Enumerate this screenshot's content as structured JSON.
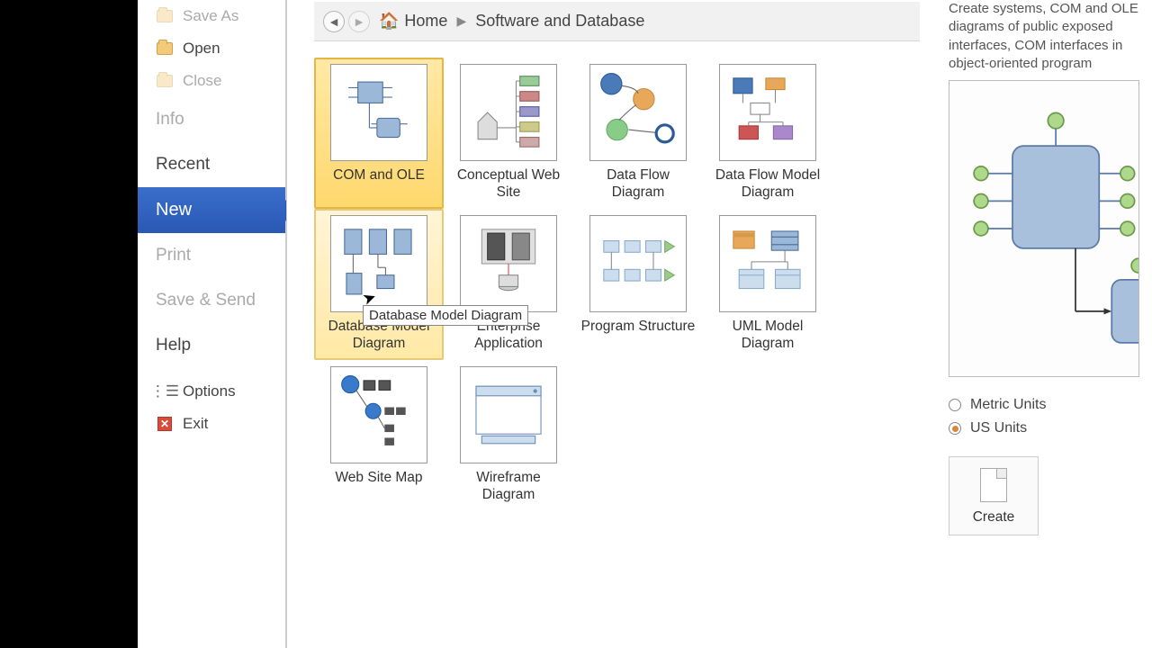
{
  "sidebar": {
    "save_as": "Save As",
    "open": "Open",
    "close": "Close",
    "info": "Info",
    "recent": "Recent",
    "new": "New",
    "print": "Print",
    "save_send": "Save & Send",
    "help": "Help",
    "options": "Options",
    "exit": "Exit"
  },
  "breadcrumb": {
    "home": "Home",
    "current": "Software and Database"
  },
  "templates": {
    "com_ole": "COM and OLE",
    "conceptual_web": "Conceptual Web Site",
    "data_flow": "Data Flow Diagram",
    "data_flow_model": "Data Flow Model Diagram",
    "db_model": "Database Model Diagram",
    "enterprise_app": "Enterprise Application",
    "program_structure": "Program Structure",
    "uml_model": "UML Model Diagram",
    "web_site_map": "Web Site Map",
    "wireframe": "Wireframe Diagram"
  },
  "tooltip": "Database Model Diagram",
  "right": {
    "desc": "Create systems, COM and OLE diagrams of public exposed interfaces, COM interfaces in object-oriented program",
    "metric": "Metric Units",
    "us": "US Units",
    "create": "Create"
  }
}
